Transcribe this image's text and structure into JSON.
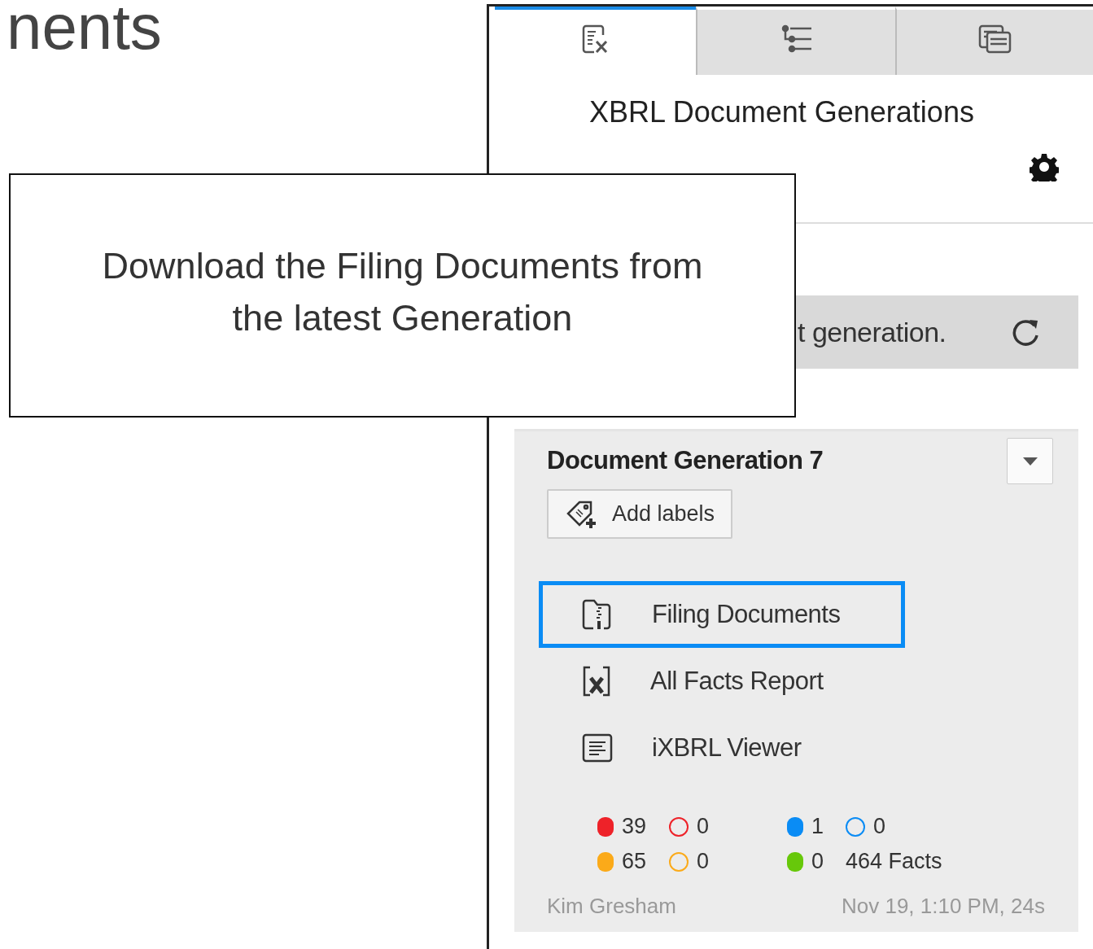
{
  "heading": "nents",
  "callout": {
    "text": "Download the Filing Documents from the latest Generation"
  },
  "tabs": [
    {
      "selected": true
    },
    {
      "selected": false
    },
    {
      "selected": false
    }
  ],
  "panel_title": "XBRL Document Generations",
  "notice": {
    "text": "t generation."
  },
  "generation": {
    "title": "Document Generation 7",
    "add_labels": "Add labels",
    "links": [
      {
        "label": "Filing Documents",
        "selected": true
      },
      {
        "label": "All Facts Report",
        "selected": false
      },
      {
        "label": "iXBRL Viewer",
        "selected": false
      }
    ],
    "stats": [
      {
        "items": [
          {
            "kind": "filled",
            "color": "#ee2229",
            "value": "39"
          },
          {
            "kind": "hollow",
            "color": "#ee2229",
            "value": "0"
          },
          {
            "kind": "filled",
            "color": "#0a8cf5",
            "value": "1"
          },
          {
            "kind": "hollow",
            "color": "#0a8cf5",
            "value": "0"
          }
        ]
      },
      {
        "items": [
          {
            "kind": "filled",
            "color": "#fbaa19",
            "value": "65"
          },
          {
            "kind": "hollow",
            "color": "#fbaa19",
            "value": "0"
          },
          {
            "kind": "filled",
            "color": "#67c80a",
            "value": "0"
          },
          {
            "kind": "text",
            "value": "464 Facts"
          }
        ]
      }
    ],
    "author": "Kim Gresham",
    "timestamp": "Nov 19, 1:10 PM, 24s"
  }
}
